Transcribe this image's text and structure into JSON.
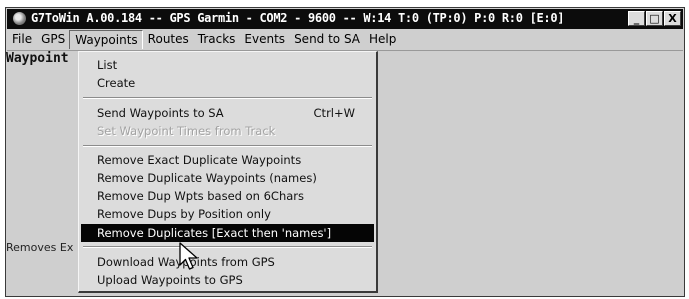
{
  "window": {
    "title": "G7ToWin A.00.184 -- GPS Garmin - COM2 - 9600 -- W:14 T:0 (TP:0) P:0 R:0 [E:0]",
    "controls": {
      "minimize": "_",
      "maximize": "□",
      "close": "X"
    }
  },
  "menubar": {
    "items": [
      {
        "label": "File"
      },
      {
        "label": "GPS"
      },
      {
        "label": "Waypoints",
        "open": true
      },
      {
        "label": "Routes"
      },
      {
        "label": "Tracks"
      },
      {
        "label": "Events"
      },
      {
        "label": "Send to SA"
      },
      {
        "label": "Help"
      }
    ]
  },
  "client": {
    "heading": "Waypoint",
    "status": "Removes Ex"
  },
  "waypoints_menu": {
    "items": [
      {
        "label": "List"
      },
      {
        "label": "Create"
      },
      {
        "label": "Send Waypoints to SA",
        "shortcut": "Ctrl+W"
      },
      {
        "label": "Set Waypoint Times from Track",
        "disabled": true
      },
      {
        "label": "Remove Exact Duplicate Waypoints"
      },
      {
        "label": "Remove Duplicate Waypoints (names)"
      },
      {
        "label": "Remove Dup Wpts based on 6Chars"
      },
      {
        "label": "Remove Dups by Position only"
      },
      {
        "label": "Remove Duplicates [Exact then 'names']",
        "highlighted": true
      },
      {
        "label": "Download Waypoints from GPS"
      },
      {
        "label": "Upload Waypoints to GPS"
      }
    ]
  },
  "icons": {
    "app": "g7towin-app-icon",
    "cursor": "mouse-pointer-icon"
  }
}
